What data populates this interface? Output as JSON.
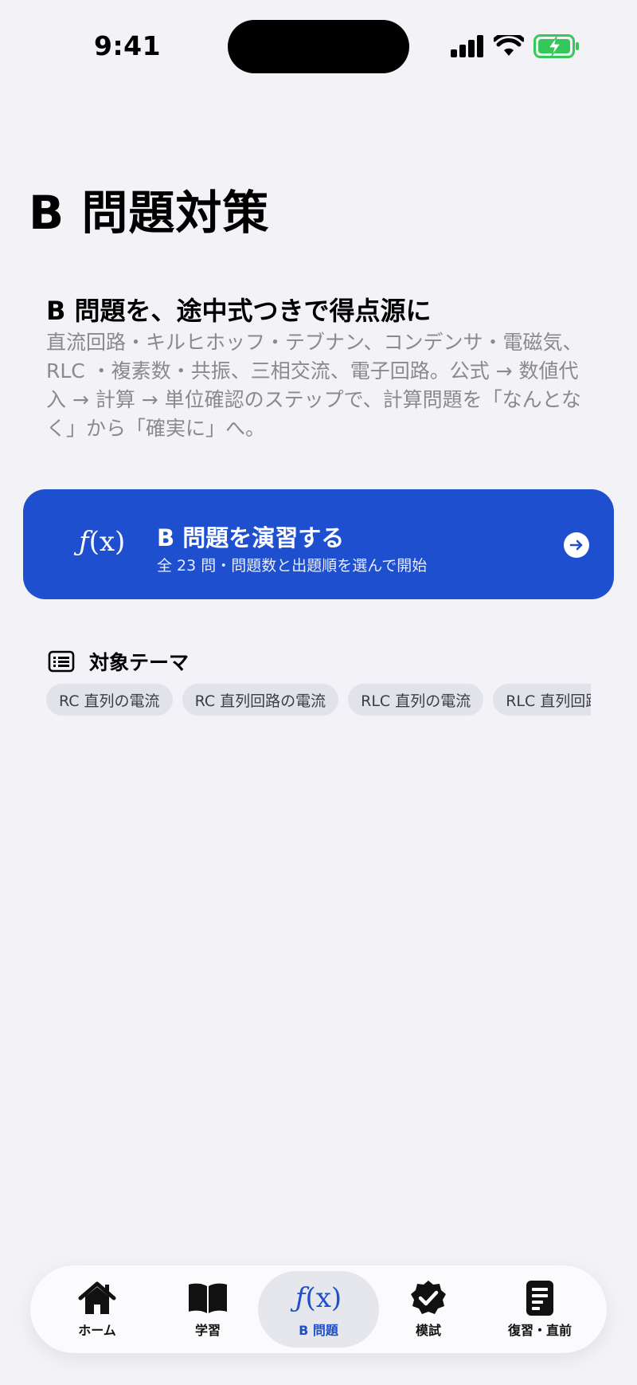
{
  "status": {
    "time": "9:41"
  },
  "page": {
    "title": "B 問題対策"
  },
  "intro": {
    "heading": "B 問題を、途中式つきで得点源に",
    "body": "直流回路・キルヒホッフ・テブナン、コンデンサ・電磁気、RLC ・複素数・共振、三相交流、電子回路。公式 → 数値代入 → 計算 → 単位確認のステップで、計算問題を「なんとなく」から「確実に」へ。"
  },
  "practice_card": {
    "icon_f": "ƒ",
    "icon_x": "(x)",
    "title": "B 問題を演習する",
    "subtitle": "全 23 問・問題数と出題順を選んで開始"
  },
  "themes": {
    "title": "対象テーマ",
    "chips": [
      "RC 直列の電流",
      "RC 直列回路の電流",
      "RLC 直列の電流",
      "RLC 直列回路の電流"
    ]
  },
  "tab_bar": {
    "items": [
      {
        "label": "ホーム",
        "icon": "house-icon"
      },
      {
        "label": "学習",
        "icon": "book-icon"
      },
      {
        "label": "B 問題",
        "icon": "function-icon",
        "glyph_f": "ƒ",
        "glyph_x": "(x)"
      },
      {
        "label": "模試",
        "icon": "checkmark-seal-icon"
      },
      {
        "label": "復習・直前",
        "icon": "document-icon"
      }
    ],
    "active_index": 2
  },
  "colors": {
    "accent": "#1e4fce",
    "background": "#f2f2f7",
    "battery_green": "#34c759"
  }
}
